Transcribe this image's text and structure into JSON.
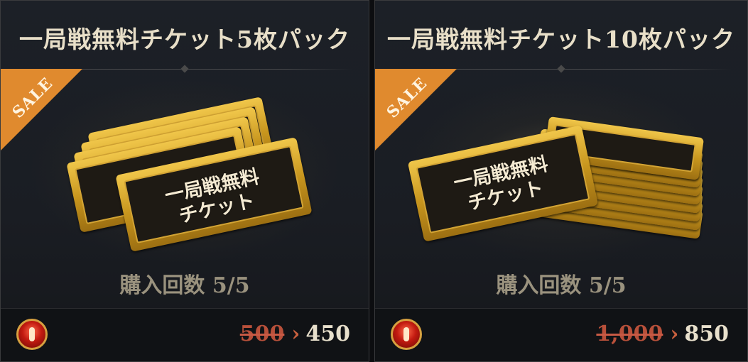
{
  "cards": [
    {
      "title": "一局戦無料チケット5枚パック",
      "sale_label": "SALE",
      "ticket_label_line1": "一局戦無料",
      "ticket_label_line2": "チケット",
      "purchase_count": "購入回数 5/5",
      "old_price": "500",
      "new_price": "450",
      "arrow": "›"
    },
    {
      "title": "一局戦無料チケット10枚パック",
      "sale_label": "SALE",
      "ticket_label_line1": "一局戦無料",
      "ticket_label_line2": "チケット",
      "purchase_count": "購入回数 5/5",
      "old_price": "1,000",
      "new_price": "850",
      "arrow": "›"
    }
  ],
  "colors": {
    "sale_ribbon": "#e08a2e",
    "ticket_gold": "#d3a434",
    "old_price": "#b8503a",
    "new_price": "#e8e0cc"
  },
  "icons": [
    "currency-gem-icon",
    "sale-ribbon",
    "ticket-stack-icon"
  ]
}
